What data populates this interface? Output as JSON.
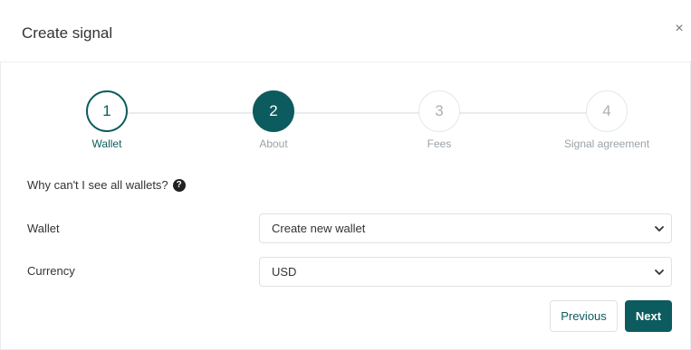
{
  "modal": {
    "title": "Create signal",
    "close_glyph": "×"
  },
  "steps": [
    {
      "number": "1",
      "label": "Wallet",
      "state": "done"
    },
    {
      "number": "2",
      "label": "About",
      "state": "active"
    },
    {
      "number": "3",
      "label": "Fees",
      "state": "pending"
    },
    {
      "number": "4",
      "label": "Signal agreement",
      "state": "pending"
    }
  ],
  "help": {
    "text": "Why can't I see all wallets?",
    "icon": "question-circle-icon",
    "icon_glyph": "?"
  },
  "form": {
    "wallet": {
      "label": "Wallet",
      "value": "Create new wallet"
    },
    "currency": {
      "label": "Currency",
      "value": "USD"
    }
  },
  "buttons": {
    "previous": "Previous",
    "next": "Next"
  },
  "colors": {
    "accent": "#0c5b5e",
    "pending": "#a9b1b5"
  }
}
